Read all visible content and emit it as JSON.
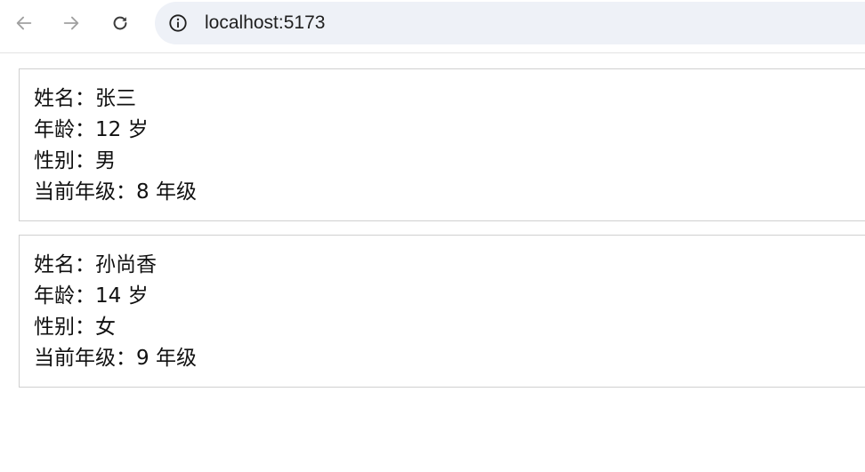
{
  "browser": {
    "url": "localhost:5173"
  },
  "students": [
    {
      "name_line": "姓名：张三",
      "age_line": "年龄：12 岁",
      "gender_line": "性别：男",
      "grade_line": "当前年级：8 年级"
    },
    {
      "name_line": "姓名：孙尚香",
      "age_line": "年龄：14 岁",
      "gender_line": "性别：女",
      "grade_line": "当前年级：9 年级"
    }
  ],
  "icons": {
    "back": "arrow-left-icon",
    "forward": "arrow-right-icon",
    "reload": "reload-icon",
    "site_info": "info-icon"
  },
  "colors": {
    "omnibox_bg": "#eef1f7",
    "card_border": "#cfcfcf",
    "text": "#111111"
  }
}
